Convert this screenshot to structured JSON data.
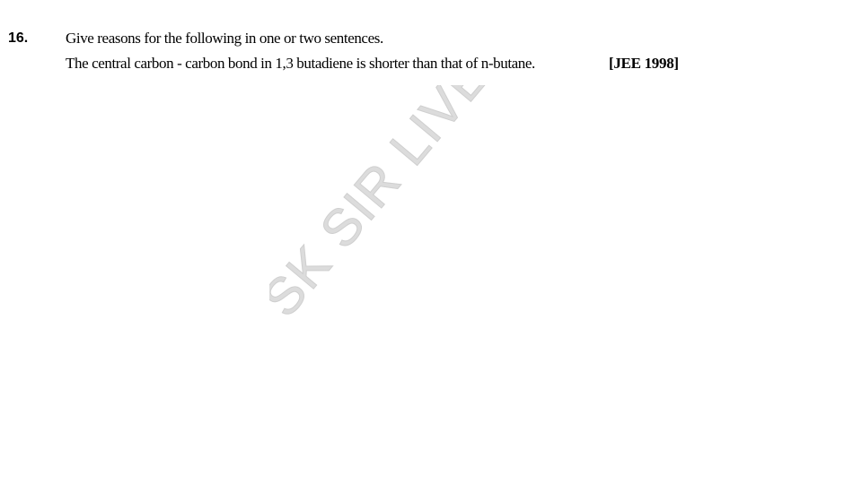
{
  "question": {
    "number": "16.",
    "prompt": "Give reasons for the following in one or two sentences.",
    "statement": "The central carbon - carbon bond in 1,3 butadiene is shorter than that of n-butane.",
    "source": "[JEE 1998]"
  },
  "watermark": {
    "text": "SK SIR LIVE",
    "color": "#d9d9d9"
  }
}
